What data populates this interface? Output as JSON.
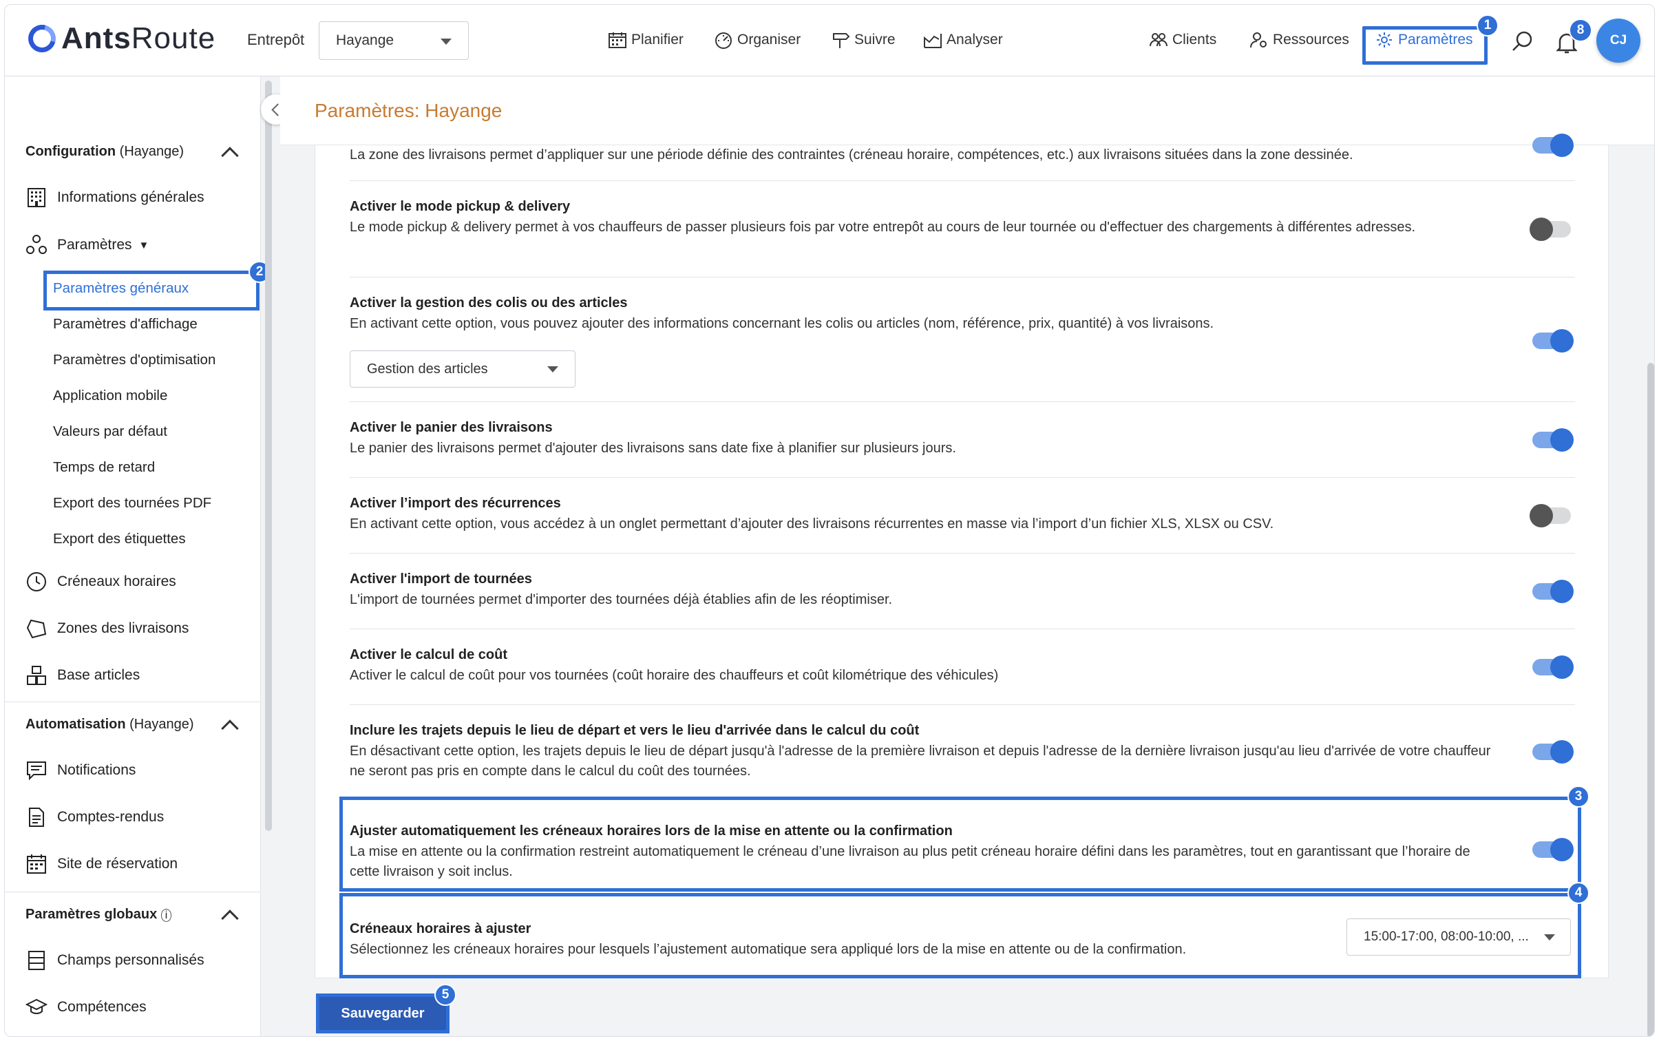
{
  "header": {
    "brand_part1": "Ants",
    "brand_part2": "Route",
    "warehouse_label": "Entrepôt",
    "warehouse_value": "Hayange",
    "nav": [
      "Planifier",
      "Organiser",
      "Suivre",
      "Analyser"
    ],
    "right_nav": [
      "Clients",
      "Ressources",
      "Paramètres"
    ],
    "notification_count": "8",
    "avatar_initials": "CJ",
    "accent_color": "#2f6fd6"
  },
  "sidebar": {
    "config_label": "Configuration",
    "config_suffix": "(Hayange)",
    "info_generales": "Informations générales",
    "parametres": "Paramètres",
    "sub_items": [
      "Paramètres généraux",
      "Paramètres d'affichage",
      "Paramètres d'optimisation",
      "Application mobile",
      "Valeurs par défaut",
      "Temps de retard",
      "Export des tournées PDF",
      "Export des étiquettes"
    ],
    "creneaux": "Créneaux horaires",
    "zones": "Zones des livraisons",
    "base_articles": "Base articles",
    "automation_label": "Automatisation",
    "automation_suffix": "(Hayange)",
    "notifications": "Notifications",
    "comptes_rendus": "Comptes-rendus",
    "site_reservation": "Site de réservation",
    "global_label": "Paramètres globaux",
    "champs": "Champs personnalisés",
    "competences": "Compétences"
  },
  "page": {
    "title": "Paramètres: Hayange",
    "top_text": "La zone des livraisons permet d’appliquer sur une période définie des contraintes (créneau horaire, compétences, etc.) aux livraisons situées dans la zone dessinée.",
    "settings": [
      {
        "title": "Activer le mode pickup & delivery",
        "desc": "Le mode pickup & delivery permet à vos chauffeurs de passer plusieurs fois par votre entrepôt au cours de leur tournée ou d'effectuer des chargements à différentes adresses.",
        "enabled": false
      },
      {
        "title": "Activer la gestion des colis ou des articles",
        "desc": "En activant cette option, vous pouvez ajouter des informations concernant les colis ou articles (nom, référence, prix, quantité) à vos livraisons.",
        "enabled": true,
        "select": "Gestion des articles"
      },
      {
        "title": "Activer le panier des livraisons",
        "desc": "Le panier des livraisons permet d'ajouter des livraisons sans date fixe à planifier sur plusieurs jours.",
        "enabled": true
      },
      {
        "title": "Activer l’import des récurrences",
        "desc": "En activant cette option, vous accédez à un onglet permettant d’ajouter des livraisons récurrentes en masse via l’import d’un fichier XLS, XLSX ou CSV.",
        "enabled": false
      },
      {
        "title": "Activer l'import de tournées",
        "desc": "L'import de tournées permet d'importer des tournées déjà établies afin de les réoptimiser.",
        "enabled": true
      },
      {
        "title": "Activer le calcul de coût",
        "desc": "Activer le calcul de coût pour vos tournées (coût horaire des chauffeurs et coût kilométrique des véhicules)",
        "enabled": true
      },
      {
        "title": "Inclure les trajets depuis le lieu de départ et vers le lieu d'arrivée dans le calcul du coût",
        "desc": "En désactivant cette option, les trajets depuis le lieu de départ jusqu'à l'adresse de la première livraison et depuis l'adresse de la dernière livraison jusqu'au lieu d'arrivée de votre chauffeur ne seront pas pris en compte dans le calcul du coût des tournées.",
        "enabled": true
      },
      {
        "title": "Ajuster automatiquement les créneaux horaires lors de la mise en attente ou la confirmation",
        "desc": "La mise en attente ou la confirmation restreint automatiquement le créneau d’une livraison au plus petit créneau horaire défini dans les paramètres, tout en garantissant que l’horaire de cette livraison y soit inclus.",
        "enabled": true
      },
      {
        "title": "Créneaux horaires à ajuster",
        "desc": "Sélectionnez les créneaux horaires pour lesquels l’ajustement automatique sera appliqué lors de la mise en attente ou de la confirmation.",
        "select": "15:00-17:00, 08:00-10:00, ..."
      }
    ],
    "save_label": "Sauvegarder"
  },
  "callouts": [
    "1",
    "2",
    "3",
    "4",
    "5"
  ]
}
